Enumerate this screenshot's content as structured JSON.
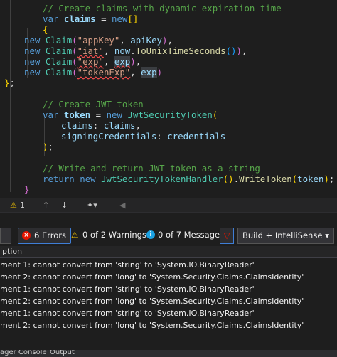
{
  "code": {
    "comment1": "// Create claims with dynamic expiration time",
    "claims_var": "claims",
    "claim_type": "Claim",
    "k1": "\"appKey\"",
    "v1": "apiKey",
    "k2": "\"iat\"",
    "v2a": "now",
    "v2b": "ToUnixTimeSeconds",
    "k3": "\"exp\"",
    "v3": "exp",
    "k4": "\"tokenExp\"",
    "v4": "exp",
    "comment2": "// Create JWT token",
    "token_var": "token",
    "jwt_type": "JwtSecurityToken",
    "p1": "claims",
    "p1v": "claims",
    "p2": "signingCredentials",
    "p2v": "credentials",
    "comment3": "// Write and return JWT token as a string",
    "handler_type": "JwtSecurityTokenHandler",
    "write_fn": "WriteToken",
    "arg": "token"
  },
  "status_bar": {
    "warning_count": "1"
  },
  "toolbar": {
    "errors": "6 Errors",
    "warnings": "0 of 2 Warnings",
    "messages": "0 of 7 Messages",
    "scope": "Build + IntelliSense"
  },
  "list_header": {
    "description": "iption"
  },
  "errors": [
    "ment 1: cannot convert from 'string' to 'System.IO.BinaryReader'",
    "ment 2: cannot convert from 'long' to 'System.Security.Claims.ClaimsIdentity'",
    "ment 1: cannot convert from 'string' to 'System.IO.BinaryReader'",
    "ment 2: cannot convert from 'long' to 'System.Security.Claims.ClaimsIdentity'",
    "ment 1: cannot convert from 'string' to 'System.IO.BinaryReader'",
    "ment 2: cannot convert from 'long' to 'System.Security.Claims.ClaimsIdentity'"
  ],
  "bottom_tabs": {
    "tab1": "ager Console",
    "tab2": "Output"
  }
}
